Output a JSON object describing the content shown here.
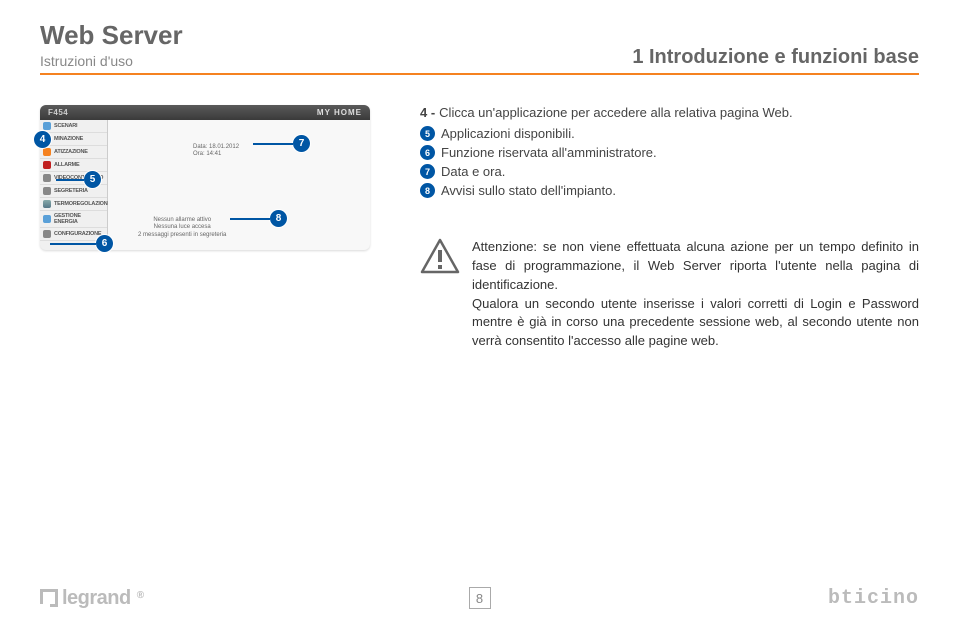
{
  "header": {
    "title": "Web Server",
    "subtitle": "Istruzioni d'uso",
    "chapter": "1 Introduzione e funzioni base"
  },
  "app": {
    "device": "F454",
    "brand": "MY HOME",
    "menu": [
      "SCENARI",
      "MINAZIONE",
      "ATIZZAZIONE",
      "ALLARME",
      "VIDEOCONTROLLO",
      "SEGRETERIA",
      "TERMOREGOLAZIONE",
      "GESTIONE ENERGIA",
      "CONFIGURAZIONE"
    ],
    "date_line1": "Data: 18.01.2012",
    "date_line2": "Ora: 14:41",
    "status_line1": "Nessun allarme attivo",
    "status_line2": "Nessuna luce accesa",
    "status_line3": "2 messaggi presenti in segreteria"
  },
  "steps": {
    "intro_num": "4 -",
    "intro_text": "Clicca un'applicazione per accedere alla relativa pagina Web.",
    "items": [
      {
        "num": "5",
        "text": "Applicazioni disponibili."
      },
      {
        "num": "6",
        "text": "Funzione riservata all'amministratore."
      },
      {
        "num": "7",
        "text": "Data e ora."
      },
      {
        "num": "8",
        "text": "Avvisi sullo stato dell'impianto."
      }
    ]
  },
  "warning": {
    "p1": "Attenzione: se non viene effettuata alcuna azione per un tempo definito in fase di programmazione, il Web Server riporta l'utente nella pagina di identificazione.",
    "p2": "Qualora un secondo utente inserisse i valori corretti di Login e Password mentre è già in corso una precedente sessione web, al secondo utente non verrà consentito l'accesso alle pagine web."
  },
  "footer": {
    "left_brand": "legrand",
    "page": "8",
    "right_brand": "bticino"
  },
  "callouts": {
    "c4": "4",
    "c5": "5",
    "c6": "6",
    "c7": "7",
    "c8": "8"
  }
}
